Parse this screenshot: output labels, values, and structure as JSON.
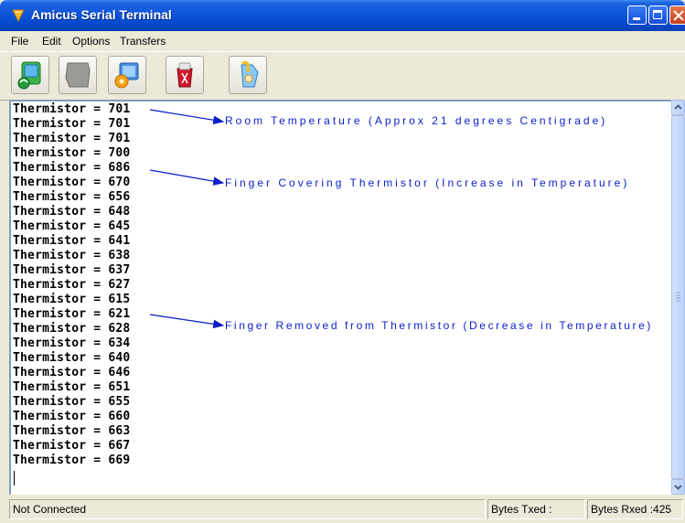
{
  "window": {
    "title": "Amicus Serial Terminal"
  },
  "menu": {
    "items": [
      "File",
      "Edit",
      "Options",
      "Transfers"
    ]
  },
  "toolbar": {
    "buttons": [
      "connect-icon",
      "disconnect-icon",
      "settings-icon",
      "clear-icon",
      "capture-icon"
    ]
  },
  "terminal": {
    "lines": [
      "Thermistor = 701",
      "Thermistor = 701",
      "Thermistor = 701",
      "Thermistor = 700",
      "Thermistor = 686",
      "Thermistor = 670",
      "Thermistor = 656",
      "Thermistor = 648",
      "Thermistor = 645",
      "Thermistor = 641",
      "Thermistor = 638",
      "Thermistor = 637",
      "Thermistor = 627",
      "Thermistor = 615",
      "Thermistor = 621",
      "Thermistor = 628",
      "Thermistor = 634",
      "Thermistor = 640",
      "Thermistor = 646",
      "Thermistor = 651",
      "Thermistor = 655",
      "Thermistor = 660",
      "Thermistor = 663",
      "Thermistor = 667",
      "Thermistor = 669"
    ],
    "annotations": [
      "Room Temperature (Approx 21 degrees Centigrade)",
      "Finger Covering Thermistor (Increase in Temperature)",
      "Finger Removed from Thermistor (Decrease in Temperature)"
    ]
  },
  "status": {
    "connection": "Not Connected",
    "bytes_txed": "Bytes Txed :",
    "bytes_rxed": "Bytes Rxed :425"
  },
  "colors": {
    "annotation": "#0a1ec8",
    "titlebar": "#0a53d8"
  }
}
